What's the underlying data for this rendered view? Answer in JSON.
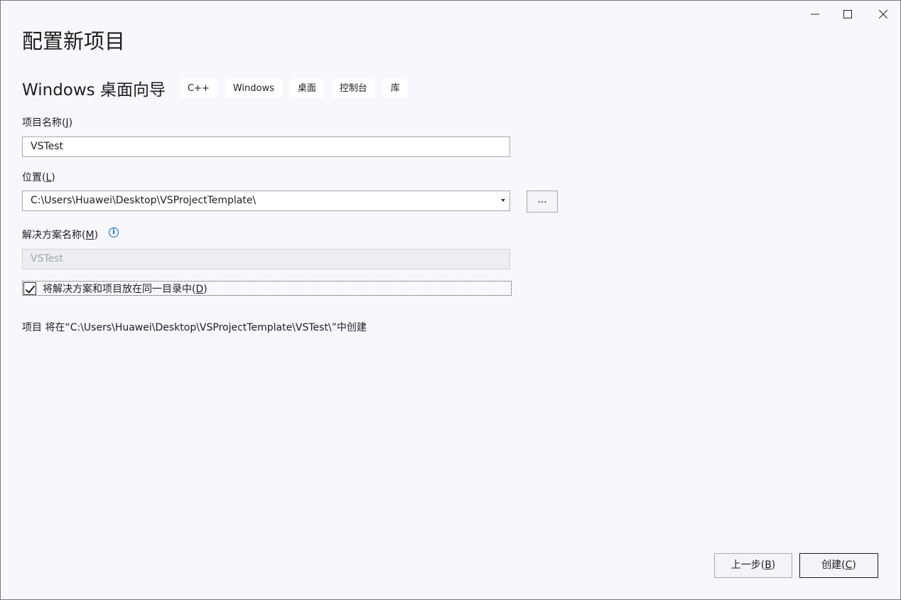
{
  "window": {
    "controls": {
      "minimize_icon": "minimize-icon",
      "maximize_icon": "maximize-icon",
      "close_icon": "close-icon"
    }
  },
  "header": {
    "title": "配置新项目",
    "template_name": "Windows 桌面向导",
    "tags": [
      "C++",
      "Windows",
      "桌面",
      "控制台",
      "库"
    ]
  },
  "form": {
    "project_name": {
      "label": "项目名称",
      "mnemonic": "J",
      "value": "VSTest"
    },
    "location": {
      "label": "位置",
      "mnemonic": "L",
      "value": "C:\\Users\\Huawei\\Desktop\\VSProjectTemplate\\",
      "browse_label": "..."
    },
    "solution_name": {
      "label": "解决方案名称",
      "mnemonic": "M",
      "value": "VSTest",
      "info_icon": "info-icon"
    },
    "same_directory": {
      "label": "将解决方案和项目放在同一目录中",
      "mnemonic": "D",
      "checked": true
    },
    "output_path": "项目 将在“C:\\Users\\Huawei\\Desktop\\VSProjectTemplate\\VSTest\\”中创建"
  },
  "footer": {
    "back": {
      "label": "上一步",
      "mnemonic": "B"
    },
    "create": {
      "label": "创建",
      "mnemonic": "C"
    }
  },
  "colors": {
    "background": "#f7f8fd",
    "info_accent": "#0a6cc4"
  }
}
